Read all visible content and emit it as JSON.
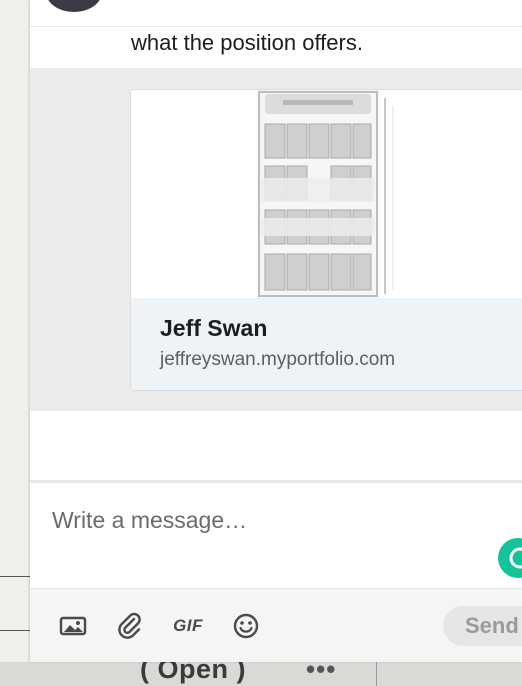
{
  "message": {
    "text": "what the position offers."
  },
  "link_preview": {
    "title": "Jeff Swan",
    "url": "jeffreyswan.myportfolio.com",
    "image_icon": "product-display-rack-image"
  },
  "composer": {
    "placeholder": "Write a message…",
    "value": "",
    "send_label": "Send",
    "assistant_icon": "grammarly-icon"
  },
  "toolbar": {
    "items": [
      {
        "name": "image-icon"
      },
      {
        "name": "paperclip-icon"
      },
      {
        "name": "gif-icon",
        "label": "GIF"
      },
      {
        "name": "emoji-icon"
      }
    ]
  },
  "background_window": {
    "open_label": "( Open )",
    "more_label": "•••"
  },
  "colors": {
    "panel_bg": "#ffffff",
    "preview_band": "#ebebeb",
    "card_footer": "#eef3f8",
    "grammarly": "#15c39a",
    "send_disabled_bg": "#e6e6e6",
    "send_disabled_text": "#9a9a9a"
  }
}
